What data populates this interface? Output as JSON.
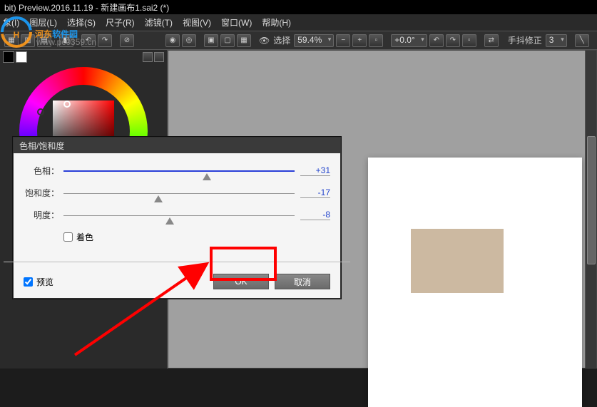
{
  "window": {
    "title": "bit) Preview.2016.11.19 - 新建画布1.sai2 (*)"
  },
  "menu": {
    "items": [
      "象(I)",
      "图层(L)",
      "选择(S)",
      "尺子(R)",
      "滤镜(T)",
      "视图(V)",
      "窗口(W)",
      "帮助(H)"
    ]
  },
  "toolbar": {
    "select_label": "选择",
    "zoom": "59.4%",
    "angle": "+0.0°",
    "stabilizer_label": "手抖修正",
    "stabilizer_value": "3"
  },
  "watermark": {
    "logo_letter": "H",
    "text1": "河东软件园",
    "text2": "www.pc0359.cn"
  },
  "canvas": {
    "rect_color": "#ccb9a1"
  },
  "dialog": {
    "title": "色相/饱和度",
    "sliders": [
      {
        "label": "色相：",
        "value": "+31",
        "pos": 62
      },
      {
        "label": "饱和度：",
        "value": "-17",
        "pos": 41
      },
      {
        "label": "明度：",
        "value": "-8",
        "pos": 46
      }
    ],
    "colorize_label": "着色",
    "preview_label": "预览",
    "ok_label": "OK",
    "cancel_label": "取消"
  }
}
